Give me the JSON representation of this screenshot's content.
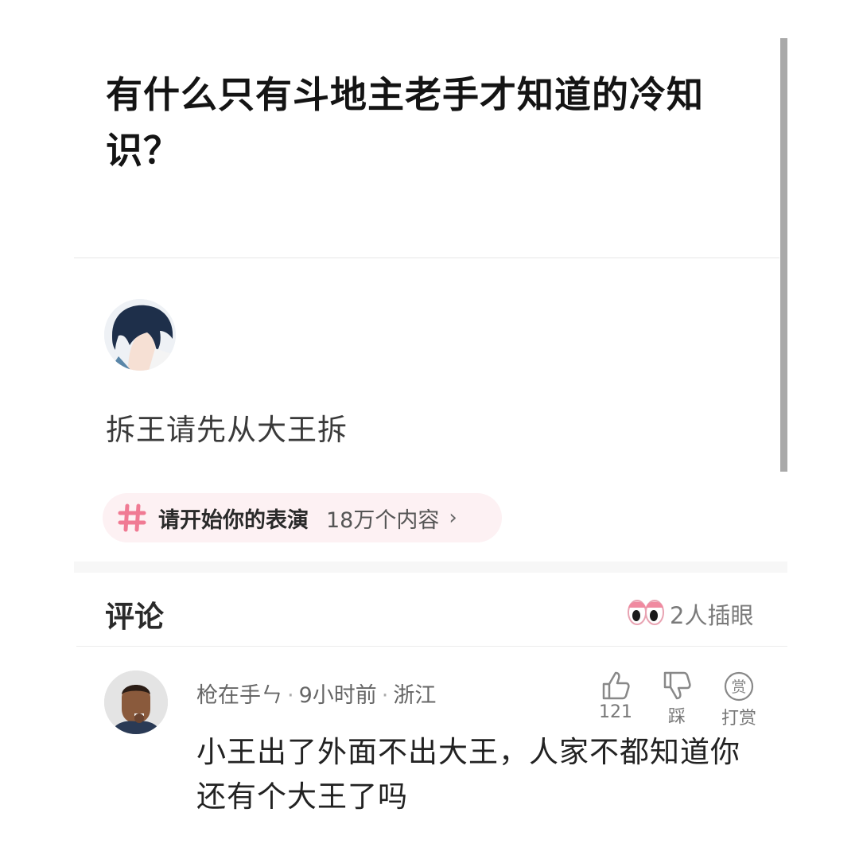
{
  "question": {
    "title": "有什么只有斗地主老手才知道的冷知识？"
  },
  "answer": {
    "avatar_icon": "anime-boy-avatar-icon",
    "text": "拆王请先从大王拆"
  },
  "topic": {
    "icon": "hash-icon",
    "name": "请开始你的表演",
    "count": "18万个内容",
    "arrow": "›"
  },
  "comments": {
    "title": "评论",
    "peek_icon": "eyes-icon",
    "peek_text": "2人插眼",
    "items": [
      {
        "author": "枪在手ㄣ",
        "time": "9小时前",
        "location": "浙江",
        "text": "小王出了外面不出大王，人家不都知道你还有个大王了吗",
        "like_count": "121",
        "dislike_label": "踩",
        "reward_label": "打赏",
        "reward_badge": "赏"
      }
    ]
  },
  "colors": {
    "topic_pill_bg": "#fdf1f3",
    "hash_icon": "#f07a93",
    "scrollbar": "#a9a9a9"
  }
}
